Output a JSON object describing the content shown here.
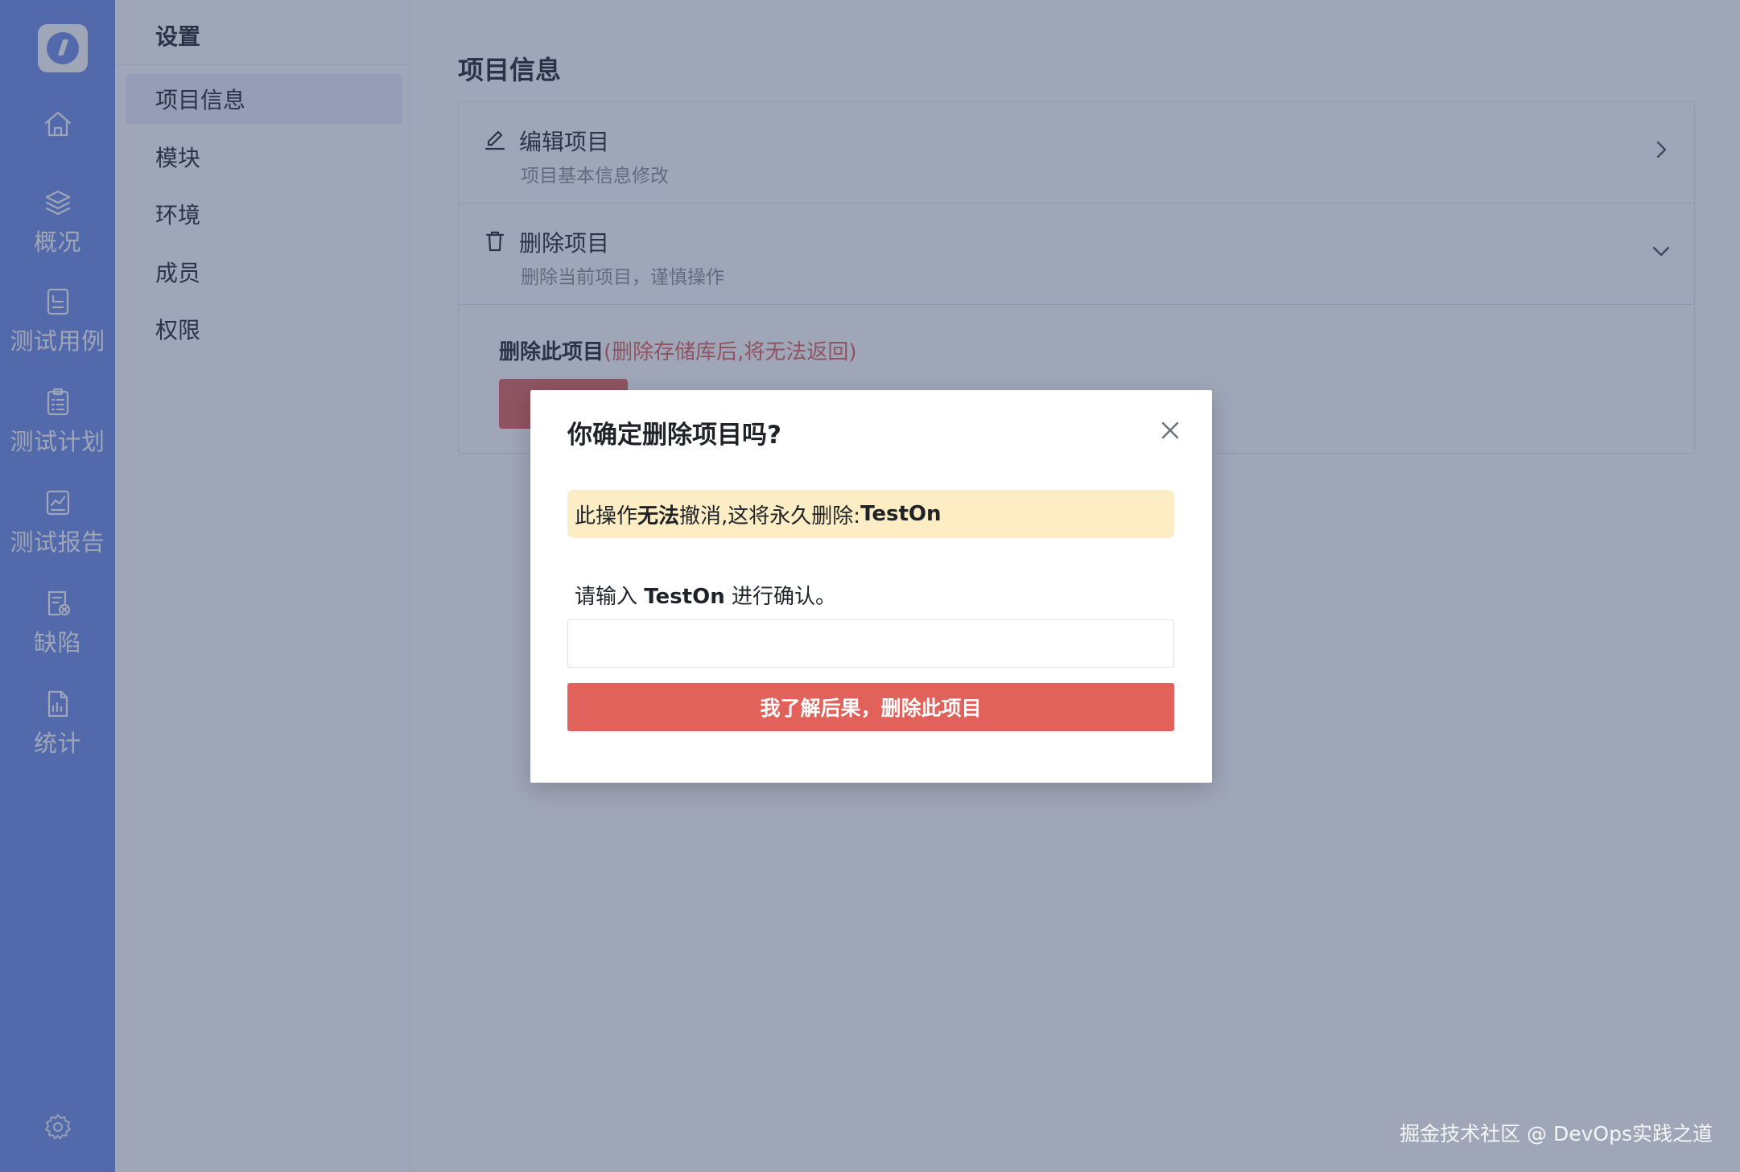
{
  "rail": {
    "items": [
      {
        "label": "",
        "icon": "home-icon"
      },
      {
        "label": "概况",
        "icon": "layers-icon"
      },
      {
        "label": "测试用例",
        "icon": "testcase-icon"
      },
      {
        "label": "测试计划",
        "icon": "clipboard-icon"
      },
      {
        "label": "测试报告",
        "icon": "report-icon"
      },
      {
        "label": "缺陷",
        "icon": "bug-doc-icon"
      },
      {
        "label": "统计",
        "icon": "chart-doc-icon"
      }
    ]
  },
  "submenu": {
    "title": "设置",
    "items": [
      {
        "label": "项目信息",
        "active": true
      },
      {
        "label": "模块"
      },
      {
        "label": "环境"
      },
      {
        "label": "成员"
      },
      {
        "label": "权限"
      }
    ]
  },
  "main": {
    "title": "项目信息",
    "rows": [
      {
        "title": "编辑项目",
        "desc": "项目基本信息修改"
      },
      {
        "title": "删除项目",
        "desc": "删除当前项目，谨慎操作"
      }
    ],
    "danger": {
      "label": "删除此项目",
      "warning": "(删除存储库后,将无法返回)"
    }
  },
  "dialog": {
    "title": "你确定删除项目吗?",
    "alert": {
      "prefix": "此操作",
      "strong": "无法",
      "middle": "撤消,这将永久删除:",
      "project": "TestOn"
    },
    "confirm": {
      "prefix": "请输入 ",
      "project": "TestOn",
      "suffix": " 进行确认。"
    },
    "input_value": "",
    "button_label": "我了解后果，删除此项目"
  },
  "watermark": "掘金技术社区 @ DevOps实践之道",
  "colors": {
    "rail": "#6b8ae8",
    "danger": "#e0625a",
    "alert_bg": "#fdedc4",
    "active_menu": "#ecf0fd"
  }
}
